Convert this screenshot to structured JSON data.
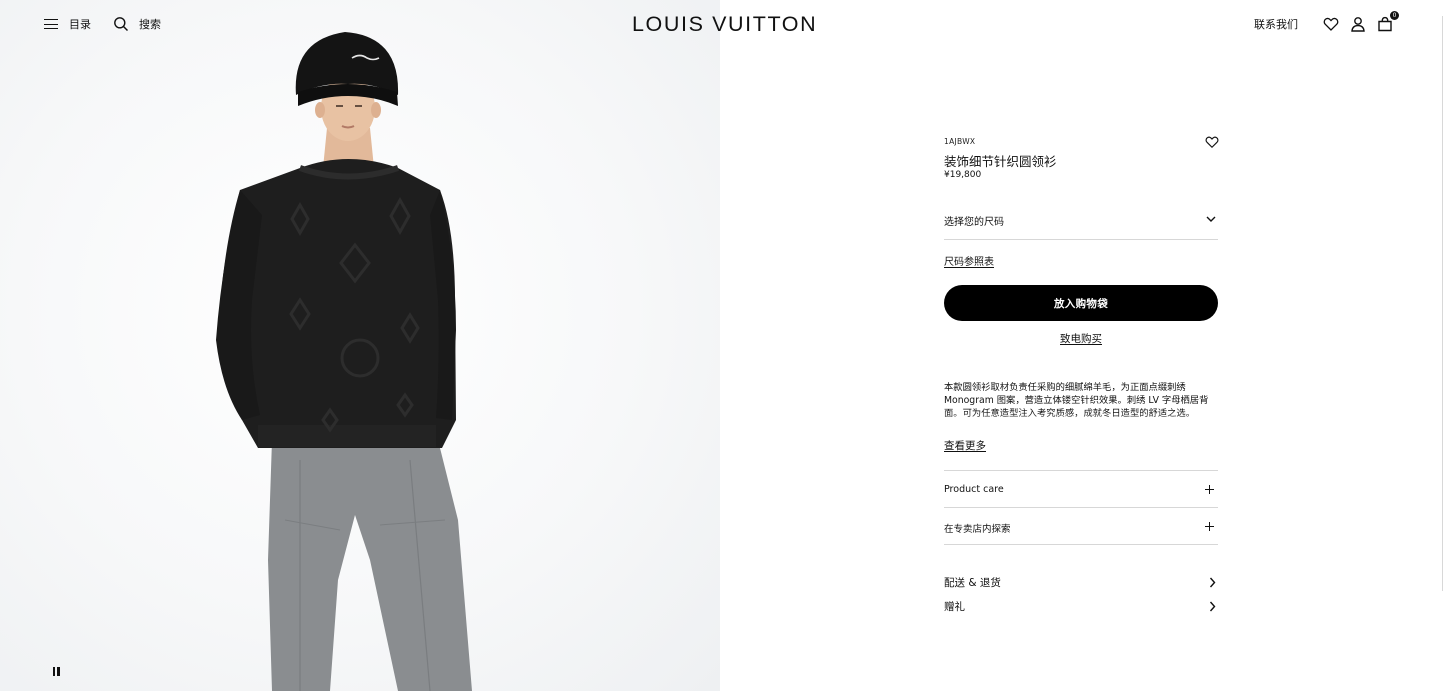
{
  "header": {
    "menu_label": "目录",
    "search_label": "搜索",
    "logo": "LOUIS VUITTON",
    "contact_label": "联系我们",
    "bag_count": "0"
  },
  "hero": {
    "icons": [
      "pause-icon"
    ]
  },
  "product": {
    "sku": "1AJBWX",
    "title": "装饰细节针织圆领衫",
    "price": "¥19,800",
    "size_select_label": "选择您的尺码",
    "size_guide_label": "尺码参照表",
    "add_to_bag_label": "放入购物袋",
    "call_to_buy_label": "致电购买",
    "description": "本款圆领衫取材负责任采购的细腻绵羊毛，为正面点缀刺绣 Monogram 图案，营造立体镂空针织效果。刺绣 LV 字母栖居背面。可为任意造型注入考究质感，成就冬日造型的舒适之选。",
    "read_more_label": "查看更多",
    "accordion": [
      {
        "label": "Product care"
      },
      {
        "label": "在专卖店内探索"
      }
    ],
    "links": [
      {
        "label": "配送 & 退货"
      },
      {
        "label": "赠礼"
      }
    ]
  },
  "colors": {
    "text": "#111111",
    "button_bg": "#000000",
    "button_text": "#ffffff",
    "divider": "#d7d7d7",
    "sweater": "#1e1e1e",
    "trousers": "#8a8d90"
  }
}
